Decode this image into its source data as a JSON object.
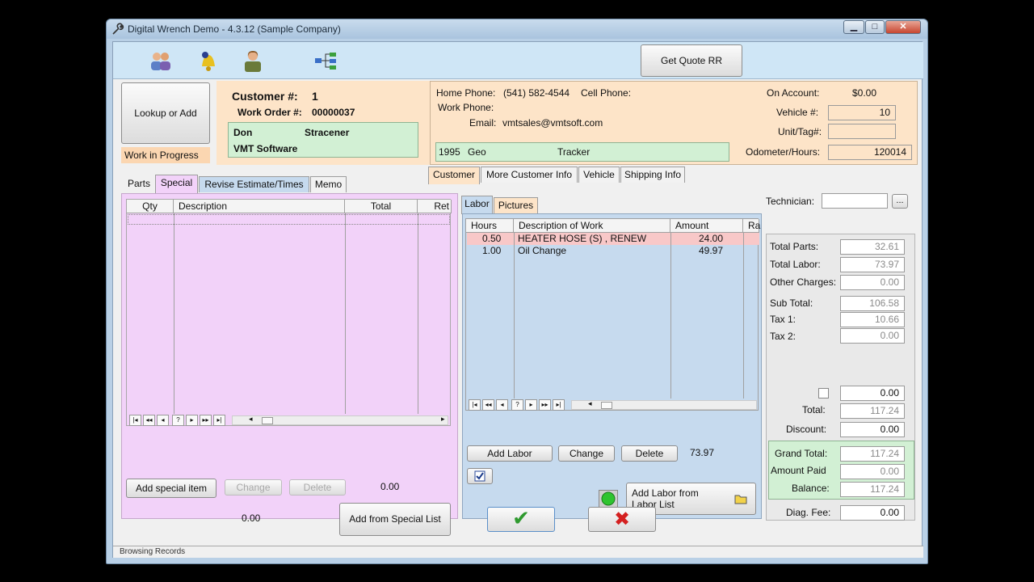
{
  "window": {
    "title": "Digital Wrench Demo - 4.3.12 (Sample Company)",
    "controls": {
      "minimize": "▁",
      "maximize": "□",
      "close": "✕"
    }
  },
  "toolbar": {
    "icons": [
      "customers-icon",
      "alert-bell-icon",
      "technician-icon",
      "network-icon"
    ],
    "get_quote_label": "Get Quote RR"
  },
  "customer": {
    "lookup_label": "Lookup or Add",
    "status_badge": "Work in Progress",
    "customer_label": "Customer #:",
    "customer_number": "1",
    "work_order_label": "Work Order #:",
    "work_order_number": "00000037",
    "first_name": "Don",
    "last_name": "Stracener",
    "company": "VMT Software",
    "home_phone_label": "Home Phone:",
    "home_phone": "(541)  582-4544",
    "cell_phone_label": "Cell Phone:",
    "work_phone_label": "Work Phone:",
    "email_label": "Email:",
    "email": "vmtsales@vmtsoft.com",
    "vehicle_year": "1995",
    "vehicle_make": "Geo",
    "vehicle_model": "Tracker",
    "on_account_label": "On Account:",
    "on_account": "$0.00",
    "vehicle_num_label": "Vehicle #:",
    "vehicle_num": "10",
    "unit_tag_label": "Unit/Tag#:",
    "unit_tag": "",
    "odometer_label": "Odometer/Hours:",
    "odometer": "120014"
  },
  "info_tabs": [
    "Customer",
    "More Customer Info",
    "Vehicle",
    "Shipping Info"
  ],
  "parts_tabs": [
    "Parts",
    "Special",
    "Revise Estimate/Times",
    "Memo"
  ],
  "special": {
    "columns": [
      "Qty",
      "Description",
      "Total",
      "Ret"
    ],
    "rows": [],
    "add_label": "Add special item",
    "change_label": "Change",
    "delete_label": "Delete",
    "total": "0.00",
    "add_from_list_label": "Add from Special List"
  },
  "labor_tabs": [
    "Labor",
    "Pictures"
  ],
  "labor": {
    "columns": [
      "Hours",
      "Description of Work",
      "Amount",
      "Ra"
    ],
    "rows": [
      {
        "hours": "0.50",
        "description": "HEATER HOSE (S) , RENEW",
        "amount": "24.00"
      },
      {
        "hours": "1.00",
        "description": "Oil Change",
        "amount": "49.97"
      }
    ],
    "add_label": "Add Labor",
    "change_label": "Change",
    "delete_label": "Delete",
    "total": "73.97",
    "add_from_list_label_1": "Add Labor from",
    "add_from_list_label_2": "Labor List"
  },
  "technician": {
    "label": "Technician:",
    "value": "",
    "browse_label": "..."
  },
  "totals": {
    "total_parts_label": "Total Parts:",
    "total_parts": "32.61",
    "total_labor_label": "Total Labor:",
    "total_labor": "73.97",
    "other_charges_label": "Other Charges:",
    "other_charges": "0.00",
    "sub_total_label": "Sub Total:",
    "sub_total": "106.58",
    "tax1_label": "Tax 1:",
    "tax1": "10.66",
    "tax2_label": "Tax 2:",
    "tax2": "0.00",
    "misc_value": "0.00",
    "total_label": "Total:",
    "total": "117.24",
    "discount_label": "Discount:",
    "discount": "0.00",
    "grand_total_label": "Grand Total:",
    "grand_total": "117.24",
    "amount_paid_label": "Amount Paid",
    "amount_paid": "0.00",
    "balance_label": "Balance:",
    "balance": "117.24",
    "diag_fee_label": "Diag. Fee:",
    "diag_fee": "0.00"
  },
  "footer": {
    "left_value": "0.00",
    "ok_symbol": "✔",
    "cancel_symbol": "✖"
  },
  "status": {
    "text": "Browsing Records"
  },
  "nav": {
    "first": "|◂",
    "prev_page": "◂◂",
    "prev": "◂",
    "help": "?",
    "next": "▸",
    "next_page": "▸▸",
    "last": "▸|",
    "scroll_left": "◂",
    "scroll_right": "▸"
  },
  "colors": {
    "accent_green": "#2f9a2f",
    "cancel_red": "#d42020"
  }
}
